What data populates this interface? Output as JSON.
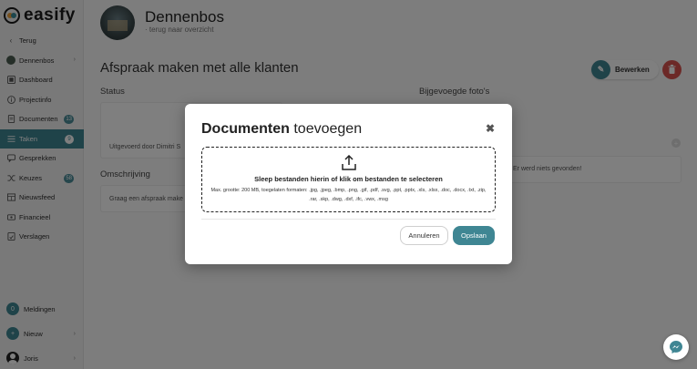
{
  "app": {
    "logo_text": "easify"
  },
  "sidebar": {
    "items": [
      {
        "label": "Terug",
        "icon": "chevron-left-icon"
      },
      {
        "label": "Dennenbos",
        "icon": "avatar"
      },
      {
        "label": "Dashboard",
        "icon": "dashboard-icon"
      },
      {
        "label": "Projectinfo",
        "icon": "info-icon"
      },
      {
        "label": "Documenten",
        "icon": "document-icon",
        "badge": "13"
      },
      {
        "label": "Taken",
        "icon": "tasks-icon",
        "badge": "9",
        "active": true
      },
      {
        "label": "Gesprekken",
        "icon": "chat-icon"
      },
      {
        "label": "Keuzes",
        "icon": "shuffle-icon",
        "badge": "58"
      },
      {
        "label": "Nieuwsfeed",
        "icon": "news-icon"
      },
      {
        "label": "Financieel",
        "icon": "finance-icon"
      },
      {
        "label": "Verslagen",
        "icon": "report-icon"
      }
    ],
    "bottom": {
      "notifications": {
        "count": "0",
        "label": "Meldingen"
      },
      "new": {
        "label": "Nieuw"
      },
      "user": {
        "label": "Joris"
      }
    }
  },
  "header": {
    "project_name": "Dennenbos",
    "back_link": "terug naar overzicht"
  },
  "main": {
    "title": "Afspraak maken met alle klanten",
    "edit_label": "Bewerken",
    "status_label": "Status",
    "status_text": "Uitgevoerd door Dimitri S",
    "description_label": "Omschrijving",
    "description_text": "Graag een afspraak make",
    "photos_label": "Bijgevoegde foto's",
    "photos_empty": "Er werd niets gevonden!"
  },
  "modal": {
    "title_bold": "Documenten",
    "title_light": "toevoegen",
    "dropzone_main": "Sleep bestanden hierin of klik om bestanden te selecteren",
    "dropzone_sub": "Max. grootte: 200 MB, toegelaten formaten: .jpg, .jpeg, .bmp, .png, .gif, .pdf, .svg, .ppt, .pptx, .xls, .xlsx, .doc, .docx, .txt, .zip, .rar, .skp, .dwg, .dxf, .ifc, .vwx, .msg",
    "cancel_label": "Annuleren",
    "save_label": "Opslaan"
  },
  "colors": {
    "accent": "#3f8693",
    "danger": "#d9534f",
    "logo_orange": "#f2a23a"
  }
}
